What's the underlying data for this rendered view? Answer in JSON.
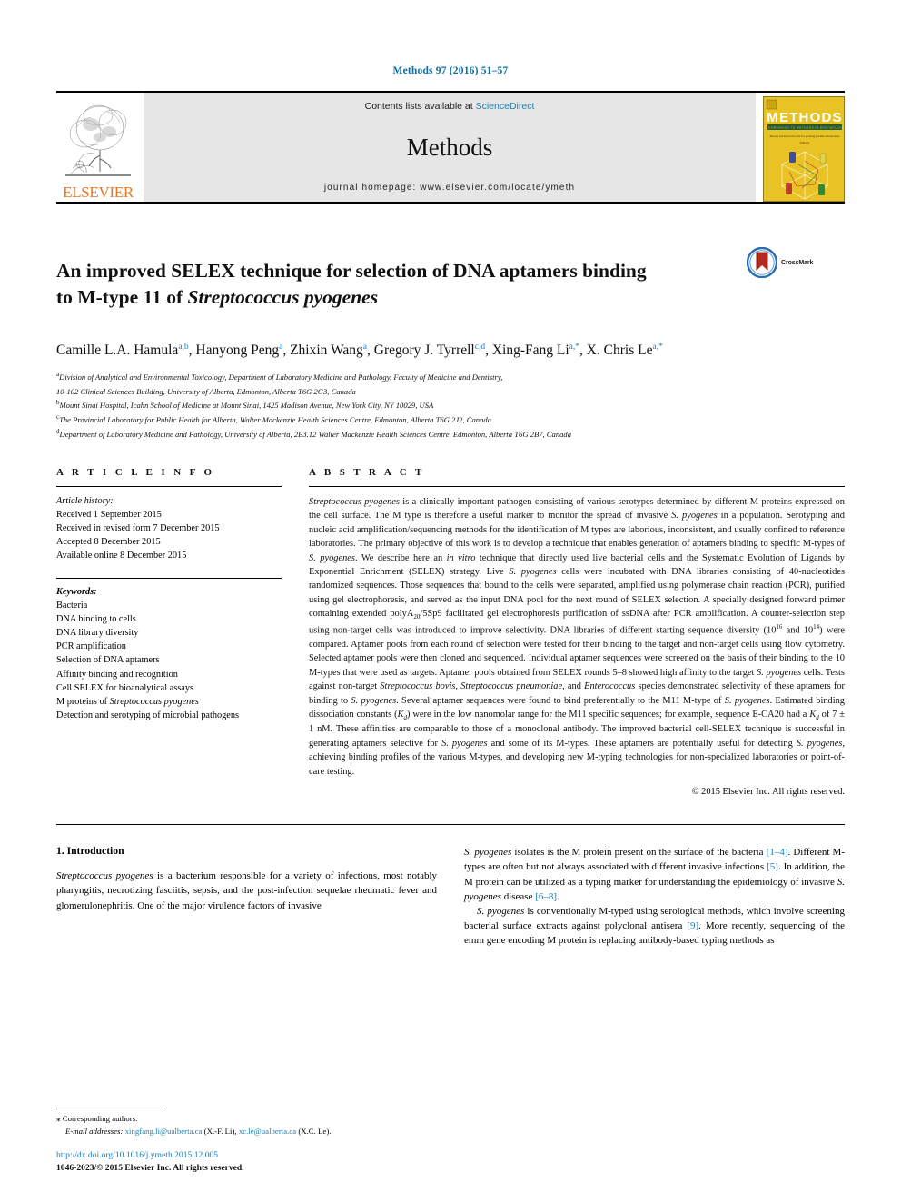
{
  "running_head": "Methods 97 (2016) 51–57",
  "masthead": {
    "publisher_name": "ELSEVIER",
    "contents_prefix": "Contents lists available at ",
    "contents_link": "ScienceDirect",
    "journal_name": "Methods",
    "homepage": "journal homepage: www.elsevier.com/locate/ymeth",
    "cover_title": "METHODS",
    "cover_subtitle": "A Companion to Methods in Enzymology",
    "cover_issue_line": "Recent advances in tools for probing protein interactions",
    "cover_editor": "Edited by"
  },
  "article": {
    "title_line1": "An improved SELEX technique for selection of DNA aptamers binding",
    "title_line2_pre": "to M-type 11 of ",
    "title_line2_italic": "Streptococcus pyogenes",
    "crossmark_label": "CrossMark",
    "authors": [
      {
        "name": "Camille L.A. Hamula",
        "sup": "a,b",
        "sep": ", "
      },
      {
        "name": "Hanyong Peng",
        "sup": "a",
        "sep": ", "
      },
      {
        "name": "Zhixin Wang",
        "sup": "a",
        "sep": ", "
      },
      {
        "name": "Gregory J. Tyrrell",
        "sup": "c,d",
        "sep": ", "
      },
      {
        "name": "Xing-Fang Li",
        "sup": "a,*",
        "sep": ", "
      },
      {
        "name": "X. Chris Le",
        "sup": "a,*",
        "sep": ""
      }
    ],
    "affiliations": [
      {
        "mark": "a",
        "text": "Division of Analytical and Environmental Toxicology, Department of Laboratory Medicine and Pathology, Faculty of Medicine and Dentistry,"
      },
      {
        "mark": "",
        "text": "10-102 Clinical Sciences Building, University of Alberta, Edmonton, Alberta T6G 2G3, Canada"
      },
      {
        "mark": "b",
        "text": "Mount Sinai Hospital, Icahn School of Medicine at Mount Sinai, 1425 Madison Avenue, New York City, NY 10029, USA"
      },
      {
        "mark": "c",
        "text": "The Provincial Laboratory for Public Health for Alberta, Walter Mackenzie Health Sciences Centre, Edmonton, Alberta T6G 2J2, Canada"
      },
      {
        "mark": "d",
        "text": "Department of Laboratory Medicine and Pathology, University of Alberta, 2B3.12 Walter Mackenzie Health Sciences Centre, Edmonton, Alberta T6G 2B7, Canada"
      }
    ]
  },
  "article_info": {
    "heading": "A R T I C L E   I N F O",
    "history_label": "Article history:",
    "history": [
      "Received 1 September 2015",
      "Received in revised form 7 December 2015",
      "Accepted 8 December 2015",
      "Available online 8 December 2015"
    ],
    "keywords_label": "Keywords:",
    "keywords": [
      "Bacteria",
      "DNA binding to cells",
      "DNA library diversity",
      "PCR amplification",
      "Selection of DNA aptamers",
      "Affinity binding and recognition",
      "Cell SELEX for bioanalytical assays",
      "M proteins of Streptococcus pyogenes",
      "Detection and serotyping of microbial pathogens"
    ]
  },
  "abstract": {
    "heading": "A B S T R A C T",
    "copyright": "© 2015 Elsevier Inc. All rights reserved."
  },
  "introduction": {
    "heading": "1. Introduction",
    "left_para1": "is a bacterium responsible for a variety of infections, most notably pharyngitis, necrotizing fasciitis, sepsis, and the post-infection sequelae rheumatic fever and glomerulonephritis. One of the major virulence factors of invasive",
    "right_para1_cont": "isolates is the M protein present on the surface of the bacteria",
    "right_para1_mid": ". Different M-types are often but not always associated with different invasive infections",
    "right_para1_mid2": ". In addition, the M protein can be utilized as a typing marker for understanding the epidemiology of invasive",
    "right_para1_tail": "disease",
    "right_para2_a": "is conventionally M-typed using serological methods, which involve screening bacterial surface extracts against polyclonal antisera",
    "right_para2_b": ". More recently, sequencing of the emm gene encoding M protein is replacing antibody-based typing methods as",
    "species": "Streptococcus pyogenes",
    "species_short": "S. pyogenes",
    "ref_1_4": "[1–4]",
    "ref_5": "[5]",
    "ref_6_8": "[6–8]",
    "ref_9": "[9]"
  },
  "footnote": {
    "star": "⁎",
    "corresponding": "Corresponding authors.",
    "email_label": "E-mail addresses:",
    "email1": "xingfang.li@ualberta.ca",
    "email1_owner": "(X.-F. Li),",
    "email2": "xc.le@ualberta.ca",
    "email2_owner": "(X.C. Le).",
    "doi": "http://dx.doi.org/10.1016/j.ymeth.2015.12.005",
    "issn_line": "1046-2023/© 2015 Elsevier Inc. All rights reserved."
  },
  "colors": {
    "link": "#1a7fb5",
    "runhead": "#0b6fa4",
    "elsevier_orange": "#E87722",
    "banner_gray": "#e6e6e6",
    "cover_yellow": "#e9c225",
    "crossmark_blue": "#2b6cb0",
    "crossmark_red": "#b32b20"
  }
}
